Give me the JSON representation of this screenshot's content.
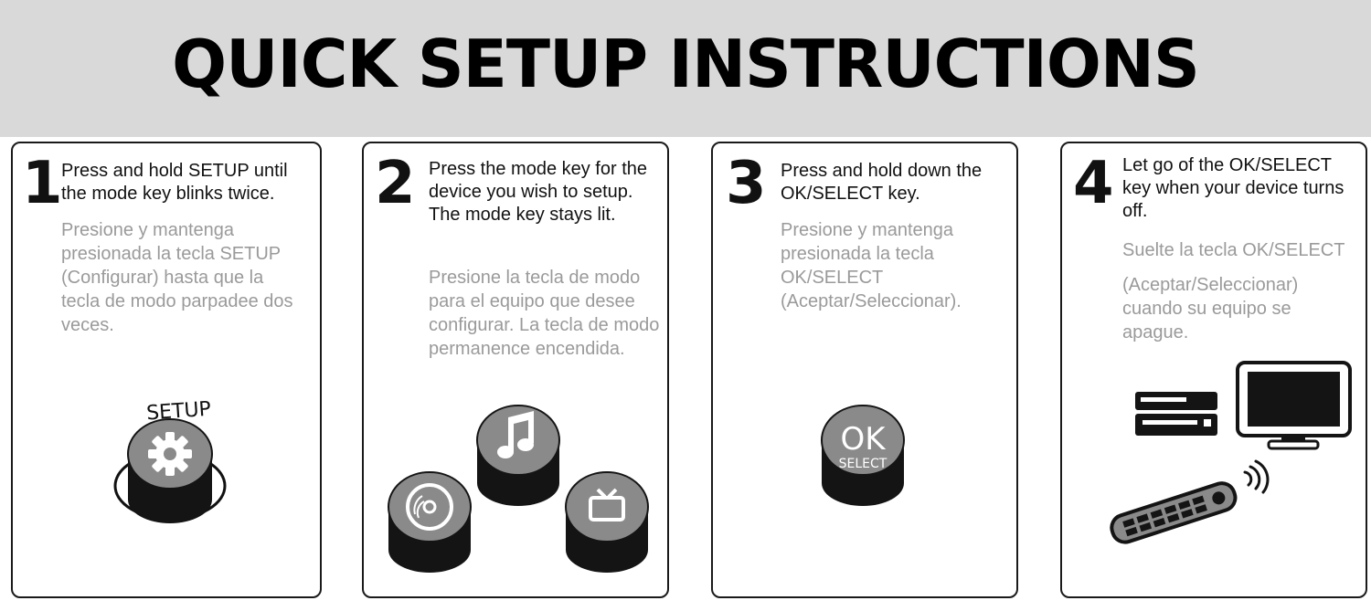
{
  "header": {
    "title": "QUICK SETUP INSTRUCTIONS"
  },
  "steps": [
    {
      "number": "1",
      "english": "Press and hold SETUP until the mode key blinks twice.",
      "spanish": "Presione y mantenga presionada la tecla SETUP (Configurar) hasta que la tecla de modo parpadee dos veces.",
      "illustration": {
        "label": "SETUP",
        "icon": "gear-icon"
      }
    },
    {
      "number": "2",
      "english": "Press the mode key for the device you wish to setup. The mode key stays lit.",
      "spanish": "Presione la tecla de modo para el equipo que desee configurar. La tecla de modo permanence encendida.",
      "illustration": {
        "icons": [
          "disc-icon",
          "music-note-icon",
          "tv-icon"
        ]
      }
    },
    {
      "number": "3",
      "english": "Press and hold down the OK/SELECT key.",
      "spanish": "Presione y mantenga presionada la tecla OK/SELECT (Aceptar/Seleccionar).",
      "illustration": {
        "key_label": "OK",
        "key_sublabel": "SELECT"
      }
    },
    {
      "number": "4",
      "english": "Let go of the OK/SELECT key when your device turns off.",
      "spanish_line1": "Suelte la tecla OK/SELECT",
      "spanish_line2": "(Aceptar/Seleccionar) cuando su equipo se apague.",
      "illustration": {
        "icons": [
          "dvd-player-icon",
          "monitor-icon",
          "remote-control-icon",
          "signal-waves-icon"
        ]
      }
    }
  ],
  "colors": {
    "banner": "#d9d9d9",
    "key_top": "#8a8a8a",
    "key_body": "#141414",
    "secondary_text": "#9a9a9a"
  }
}
